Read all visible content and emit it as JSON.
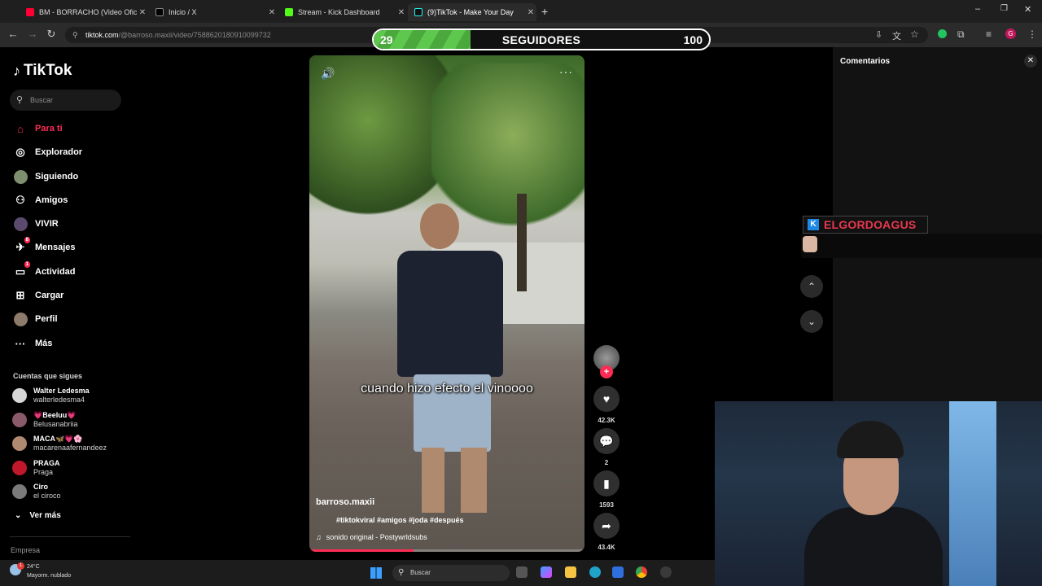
{
  "browser": {
    "tabs": [
      {
        "label": "BM - BORRACHO (Video Oficial)",
        "color": "#ff0033",
        "active": false
      },
      {
        "label": "Inicio / X",
        "color": "#000000",
        "active": false
      },
      {
        "label": "Stream - Kick Dashboard",
        "color": "#53fc18",
        "active": false
      },
      {
        "label": "(9)TikTok - Make Your Day",
        "color": "#111111",
        "active": true
      }
    ],
    "new_tab": "+",
    "url_host": "tiktok.com",
    "url_path": "/@barroso.maxii/video/7588620180910099732"
  },
  "overlay": {
    "followers_current": "29",
    "followers_label": "SEGUIDORES",
    "followers_goal": "100",
    "progress_fraction": 0.29
  },
  "sidebar": {
    "logo": "TikTok",
    "search_placeholder": "Buscar",
    "items": [
      {
        "label": "Para ti",
        "icon": "home-icon"
      },
      {
        "label": "Explorador",
        "icon": "compass-icon"
      },
      {
        "label": "Siguiendo",
        "icon": "avatar-icon"
      },
      {
        "label": "Amigos",
        "icon": "friends-icon"
      },
      {
        "label": "VIVIR",
        "icon": "live-icon"
      },
      {
        "label": "Mensajes",
        "icon": "message-icon",
        "badge": "8"
      },
      {
        "label": "Actividad",
        "icon": "activity-icon",
        "badge": "1"
      },
      {
        "label": "Cargar",
        "icon": "upload-icon"
      },
      {
        "label": "Perfil",
        "icon": "profile-icon"
      },
      {
        "label": "Más",
        "icon": "more-icon"
      }
    ],
    "follows_title": "Cuentas que sigues",
    "follows": [
      {
        "name": "Walter Ledesma",
        "handle": "walterledesma4",
        "color": "#d7d7d7"
      },
      {
        "name": "💗Beeluu💗",
        "handle": "Belusanabriia",
        "color": "#8a5a6a"
      },
      {
        "name": "MACA🦋💗🌸",
        "handle": "macarenaafernandeez",
        "color": "#b08a70"
      },
      {
        "name": "PRAGA",
        "handle": "Praga",
        "color": "#c0182a"
      },
      {
        "name": "Ciro",
        "handle": "el ciroco",
        "color": "#7a7a7a"
      }
    ],
    "see_more": "Ver más",
    "footer": "Empresa"
  },
  "video": {
    "caption": "cuando hizo efecto el vinoooo",
    "author": "barroso.maxii",
    "tags": "#tiktokviral #amigos #joda #después",
    "sound": "sonido original - Postywrldsubs",
    "progress": 0.38
  },
  "actions": {
    "likes": "42.3K",
    "comments": "2",
    "saves": "1593",
    "shares": "43.4K"
  },
  "comments_panel": {
    "title": "Comentarios"
  },
  "streamer": {
    "name": "ELGORDOAGUS"
  },
  "taskbar": {
    "temperature": "24°C",
    "condition": "Mayorm. nublado",
    "search_placeholder": "Buscar",
    "weather_badge": "1"
  }
}
